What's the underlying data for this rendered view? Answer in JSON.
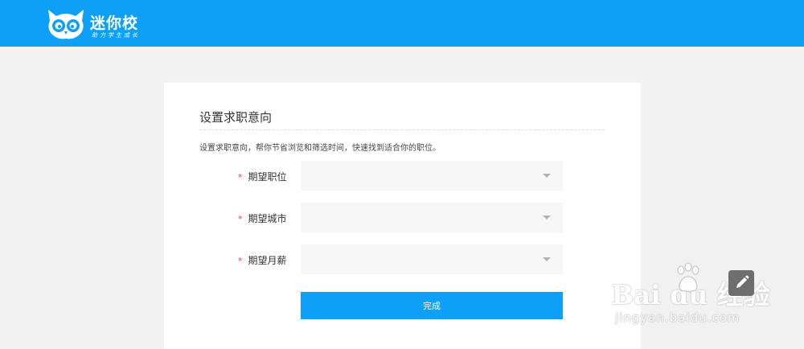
{
  "header": {
    "logo_name": "迷你校",
    "logo_slogan": "助力学生成长"
  },
  "card": {
    "title": "设置求职意向",
    "description": "设置求职意向，帮你节省浏览和筛选时间，快速找到适合你的职位。",
    "fields": [
      {
        "required_mark": "*",
        "label": "期望职位",
        "value": ""
      },
      {
        "required_mark": "*",
        "label": "期望城市",
        "value": ""
      },
      {
        "required_mark": "*",
        "label": "期望月薪",
        "value": ""
      }
    ],
    "submit_label": "完成"
  },
  "watermark": {
    "brand": "Bai du 经验",
    "url": "jingyan.baidu.com"
  },
  "colors": {
    "brand_blue": "#0ea0f6",
    "required_red": "#e9484a",
    "page_bg": "#f2f2f2",
    "select_bg": "#f7f7f7"
  }
}
